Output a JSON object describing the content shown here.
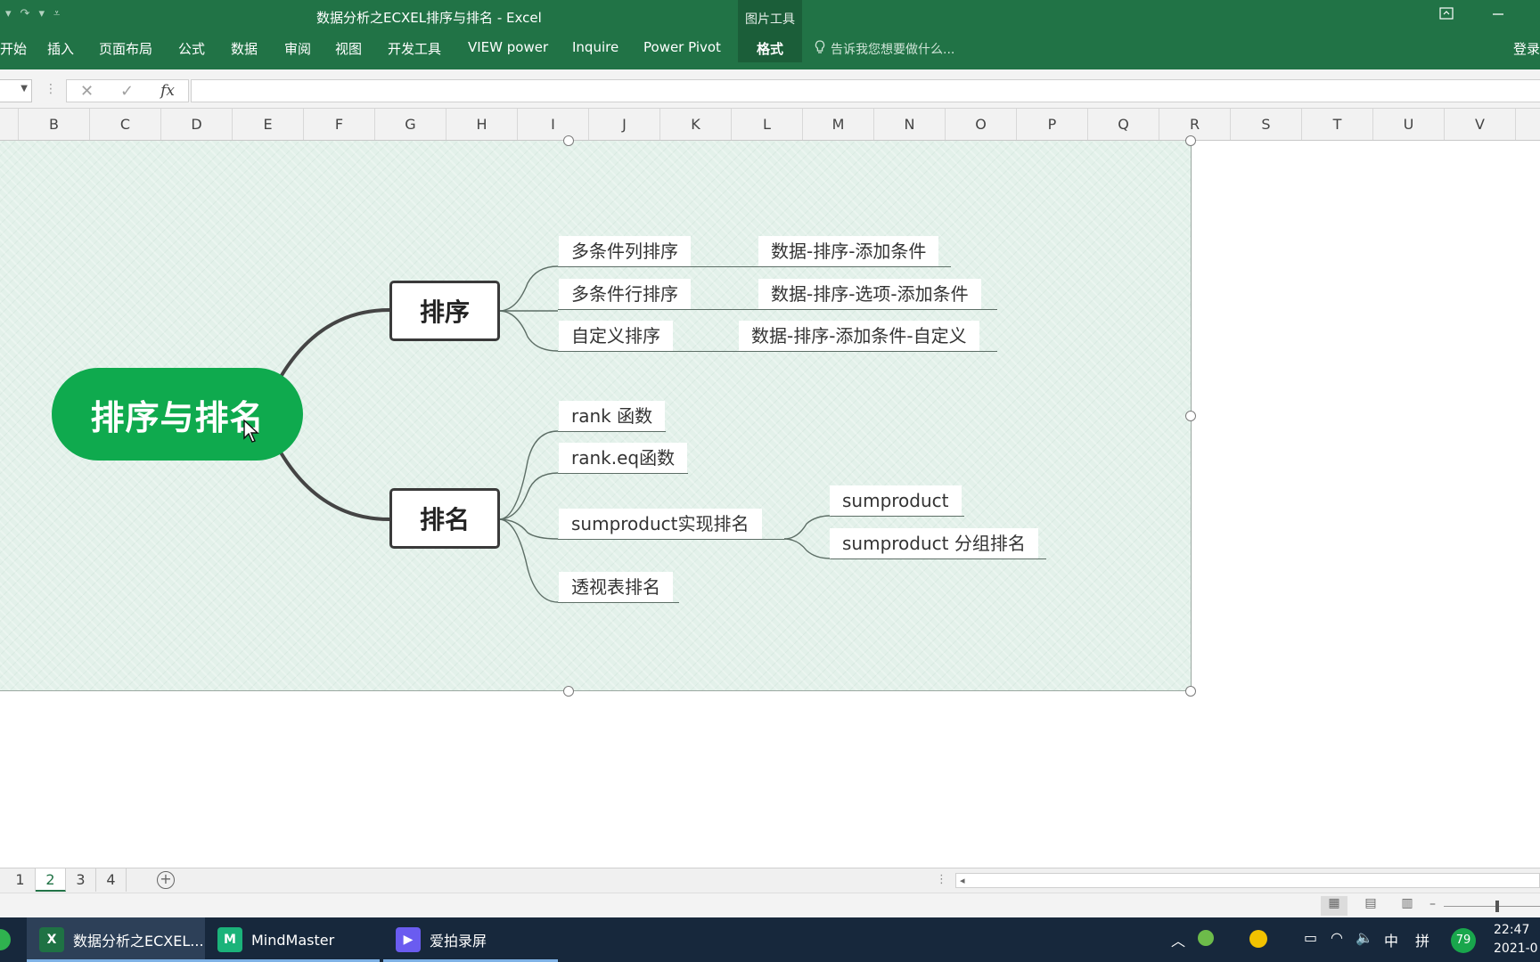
{
  "window": {
    "title": "数据分析之ECXEL排序与排名 - Excel",
    "contextual_group": "图片工具",
    "contextual_tab": "格式",
    "tell_me": "告诉我您想要做什么...",
    "login": "登录"
  },
  "ribbon_tabs": [
    "开始",
    "插入",
    "页面布局",
    "公式",
    "数据",
    "审阅",
    "视图",
    "开发工具",
    "VIEW power",
    "Inquire",
    "Power Pivot"
  ],
  "formula_bar": {
    "fx_label": "fx",
    "value": ""
  },
  "columns": [
    "B",
    "C",
    "D",
    "E",
    "F",
    "G",
    "H",
    "I",
    "J",
    "K",
    "L",
    "M",
    "N",
    "O",
    "P",
    "Q",
    "R",
    "S",
    "T",
    "U",
    "V"
  ],
  "mindmap": {
    "root": "排序与排名",
    "branches": [
      {
        "label": "排序",
        "leaves": [
          {
            "label": "多条件列排序",
            "detail": "数据-排序-添加条件"
          },
          {
            "label": "多条件行排序",
            "detail": "数据-排序-选项-添加条件"
          },
          {
            "label": "自定义排序",
            "detail": "数据-排序-添加条件-自定义"
          }
        ]
      },
      {
        "label": "排名",
        "leaves": [
          {
            "label": "rank 函数"
          },
          {
            "label": "rank.eq函数"
          },
          {
            "label": "sumproduct实现排名",
            "children": [
              "sumproduct",
              "sumproduct 分组排名"
            ]
          },
          {
            "label": "透视表排名"
          }
        ]
      }
    ]
  },
  "sheet_tabs": [
    "1",
    "2",
    "3",
    "4"
  ],
  "active_sheet": "2",
  "taskbar": {
    "apps": [
      {
        "label": "数据分析之ECXEL...",
        "icon": "excel-icon",
        "color": "#1f7244"
      },
      {
        "label": "MindMaster",
        "icon": "mindmaster-icon",
        "color": "#1bb37a"
      },
      {
        "label": "爱拍录屏",
        "icon": "aipai-icon",
        "color": "#6a5cf0"
      }
    ],
    "ime_lang": "中",
    "ime_mode": "拼",
    "badge": "79",
    "time": "22:47",
    "date": "2021-0"
  }
}
